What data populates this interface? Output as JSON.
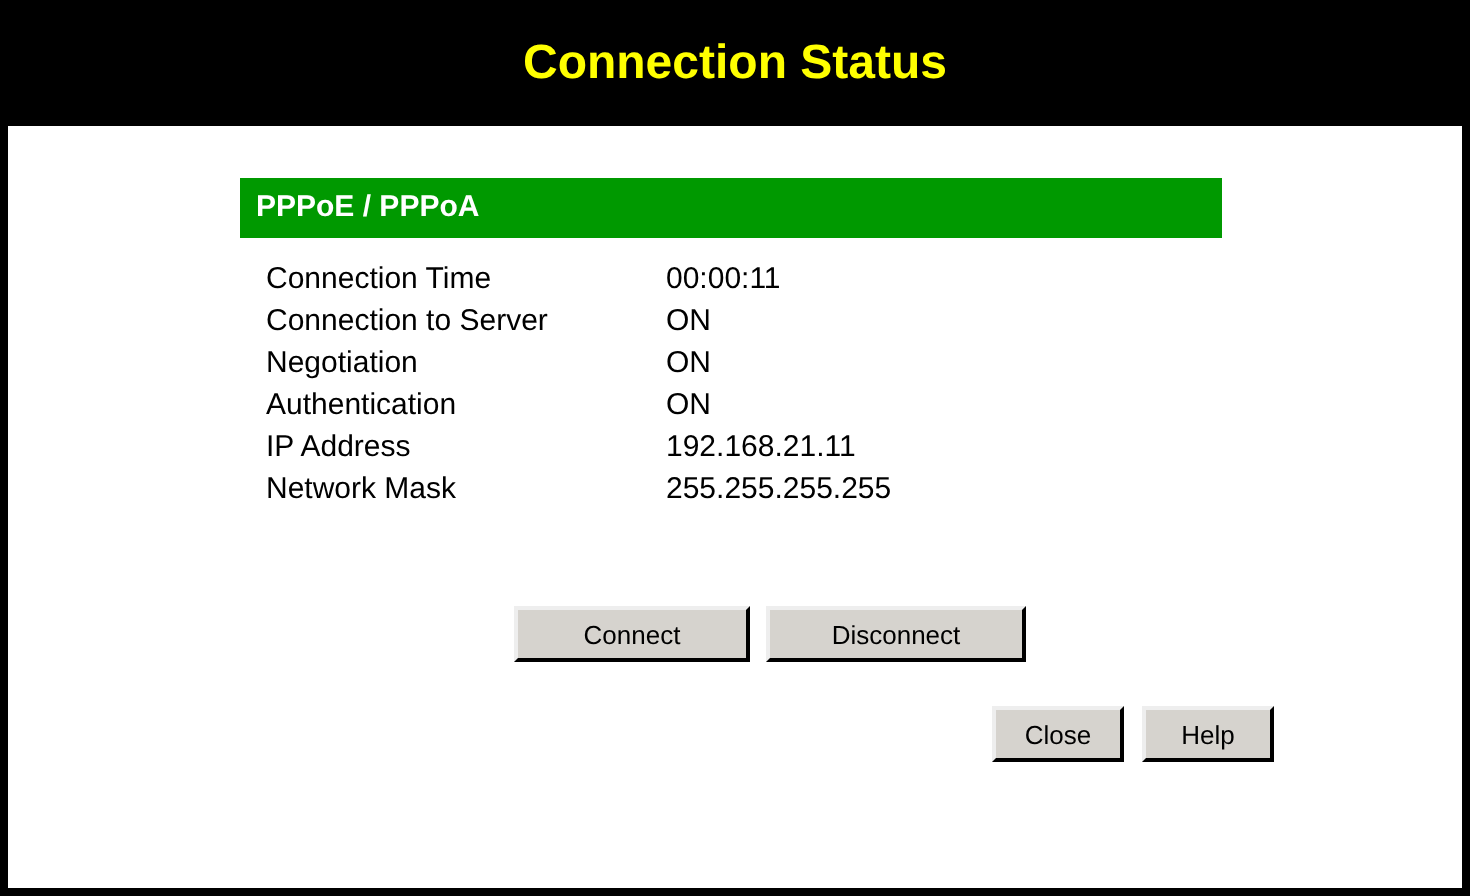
{
  "window": {
    "title": "Connection Status"
  },
  "section": {
    "title": "PPPoE / PPPoA"
  },
  "rows": [
    {
      "label": "Connection Time",
      "value": "00:00:11"
    },
    {
      "label": "Connection to Server",
      "value": "ON"
    },
    {
      "label": "Negotiation",
      "value": "ON"
    },
    {
      "label": "Authentication",
      "value": "ON"
    },
    {
      "label": "IP Address",
      "value": "192.168.21.11"
    },
    {
      "label": "Network Mask",
      "value": "255.255.255.255"
    }
  ],
  "actions": [
    "Connect",
    "Disconnect"
  ],
  "buttons": [
    "Close",
    "Help"
  ]
}
